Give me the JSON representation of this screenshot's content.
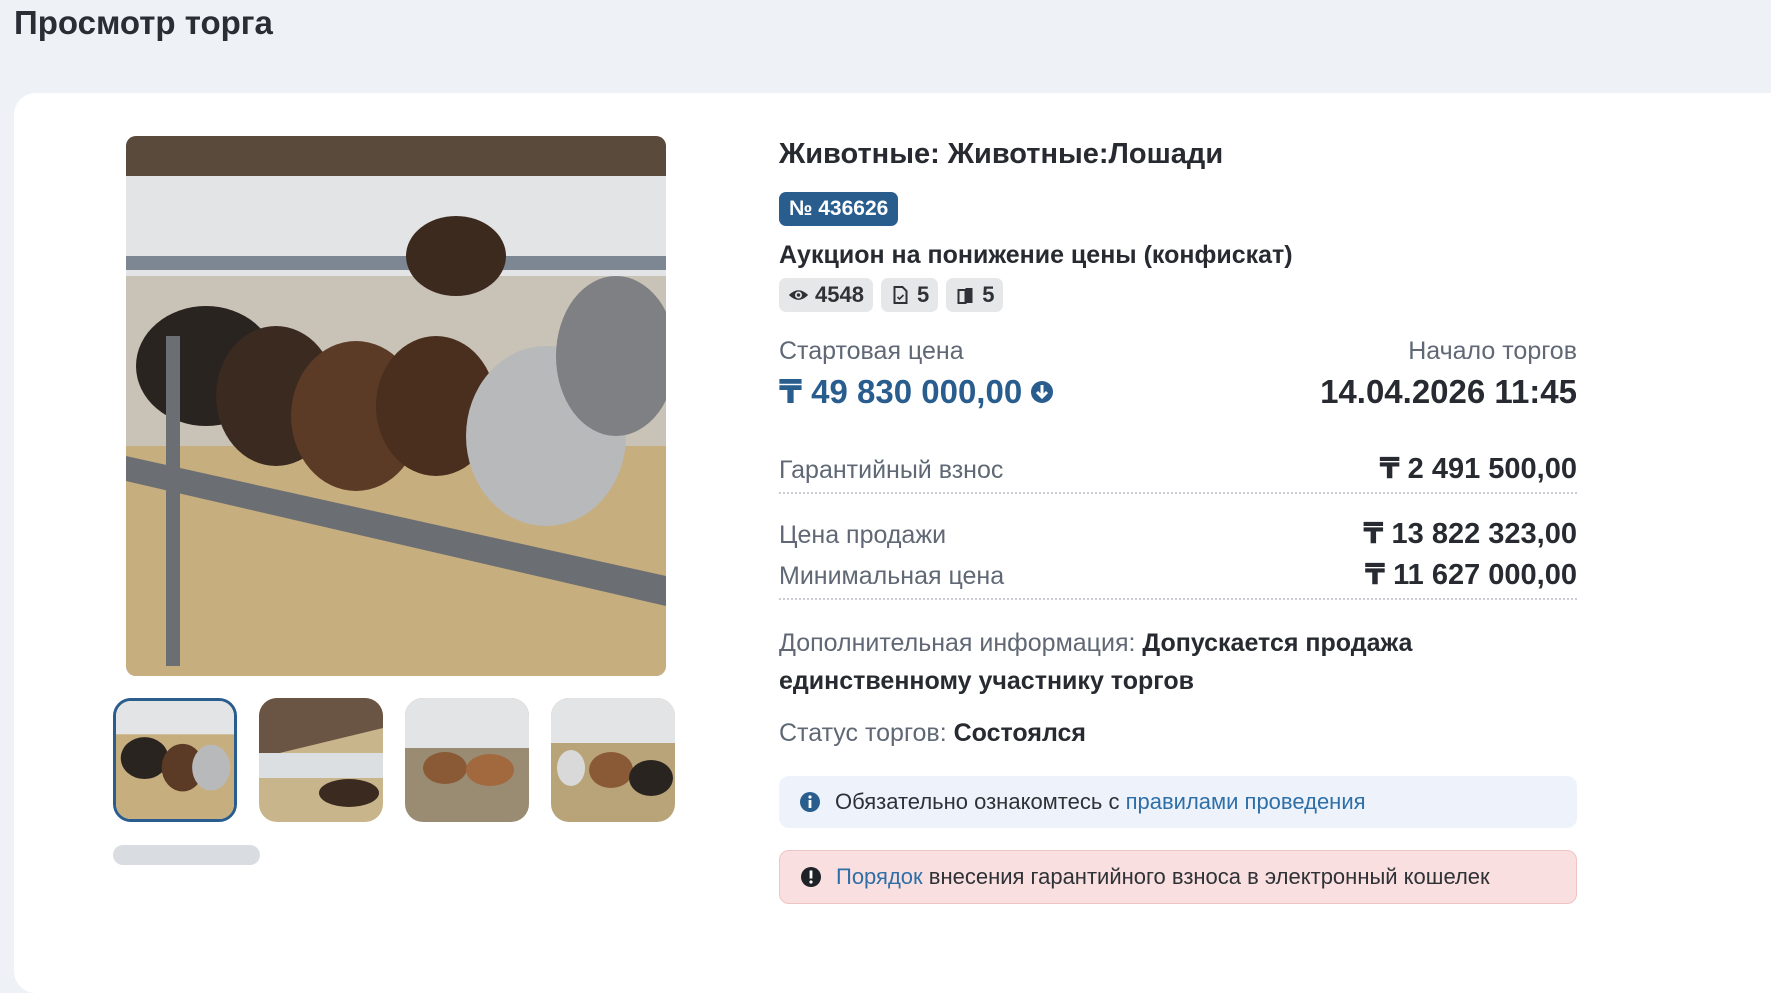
{
  "page": {
    "title": "Просмотр торга"
  },
  "lot": {
    "category": "Животные: Животные:Лошади",
    "number": "№ 436626",
    "type": "Аукцион на понижение цены (конфискат)",
    "stats": {
      "views": "4548",
      "documents": "5",
      "bids": "5"
    }
  },
  "prices": {
    "start_label": "Стартовая цена",
    "start_value": "₸ 49 830 000,00",
    "date_label": "Начало торгов",
    "date_value": "14.04.2026 11:45",
    "guarantee_label": "Гарантийный взнос",
    "guarantee_value": "₸ 2 491 500,00",
    "sale_label": "Цена продажи",
    "sale_value": "₸ 13 822 323,00",
    "min_label": "Минимальная цена",
    "min_value": "₸ 11 627 000,00"
  },
  "extra": {
    "label": "Дополнительная информация:",
    "value": "Допускается продажа единственному участнику торгов"
  },
  "status": {
    "label": "Статус торгов:",
    "value": "Состоялся"
  },
  "notes": {
    "rules_prefix": "Обязательно ознакомтесь с",
    "rules_link": "правилами проведения",
    "order_link": "Порядок",
    "order_suffix": "внесения гарантийного взноса в электронный кошелек"
  },
  "colors": {
    "accent": "#285d8e",
    "link": "#2f6fa8",
    "info_bg": "#eef3fb",
    "warn_bg": "#f9dfdf"
  },
  "icons": [
    "eye-icon",
    "document-icon",
    "bid-icon",
    "down-arrow-circle-icon",
    "info-icon"
  ]
}
